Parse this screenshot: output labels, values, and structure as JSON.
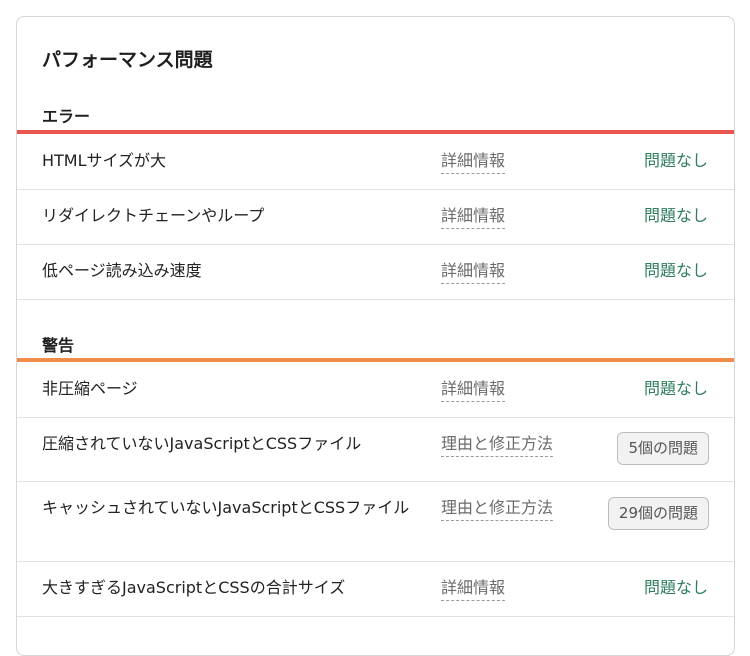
{
  "card": {
    "title": "パフォーマンス問題"
  },
  "colors": {
    "error_bar": "#e8564f",
    "warning_bar": "#f08c4a",
    "ok_text": "#2e7d5b"
  },
  "sections": [
    {
      "title": "エラー",
      "rows": [
        {
          "label": "HTMLサイズが大",
          "link": "詳細情報",
          "status": "問題なし"
        },
        {
          "label": "リダイレクトチェーンやループ",
          "link": "詳細情報",
          "status": "問題なし"
        },
        {
          "label": "低ページ読み込み速度",
          "link": "詳細情報",
          "status": "問題なし"
        }
      ]
    },
    {
      "title": "警告",
      "rows": [
        {
          "label": "非圧縮ページ",
          "link": "詳細情報",
          "status": "問題なし"
        },
        {
          "label": "圧縮されていないJavaScriptとCSSファイル",
          "link": "理由と修正方法",
          "badge": "5個の問題"
        },
        {
          "label": "キャッシュされていないJavaScriptとCSSファイル",
          "link": "理由と修正方法",
          "badge": "29個の問題"
        },
        {
          "label": "大きすぎるJavaScriptとCSSの合計サイズ",
          "link": "詳細情報",
          "status": "問題なし"
        }
      ]
    }
  ]
}
